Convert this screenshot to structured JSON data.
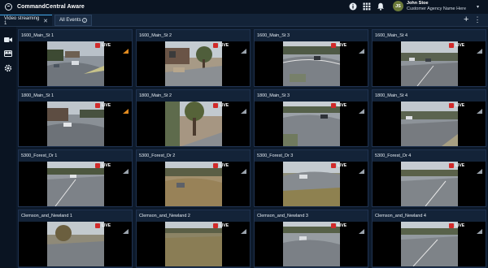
{
  "app": {
    "title": "CommandCentral Aware"
  },
  "user": {
    "initials": "JS",
    "name": "John Stoe",
    "agency": "Customer Agency Name Here"
  },
  "tabs": [
    {
      "label": "Video streaming 1",
      "active": true
    },
    {
      "label": "All Events",
      "active": false
    }
  ],
  "live_label": "LIVE",
  "icons": {
    "top": [
      "info-icon",
      "grid-apps-icon",
      "bell-icon"
    ],
    "sidebar": [
      "video-camera-icon",
      "video-wall-icon",
      "settings-icon"
    ]
  },
  "colors": {
    "accent": "#3fa1e0",
    "live": "#d12a2a",
    "signal": "#e08a1f"
  },
  "cameras": [
    "1600_Main_St 1",
    "1600_Main_St 2",
    "1600_Main_St 3",
    "1600_Main_St 4",
    "1800_Main_St 1",
    "1800_Main_St 2",
    "1800_Main_St 3",
    "1800_Main_St 4",
    "5300_Forest_Dr 1",
    "5300_Forest_Dr 2",
    "5300_Forest_Dr 3",
    "5300_Forest_Dr 4",
    "Clemson_and_Newland 1",
    "Clemson_and_Newland 2",
    "Clemson_and_Newland 3",
    "Clemson_and_Newland 4"
  ]
}
